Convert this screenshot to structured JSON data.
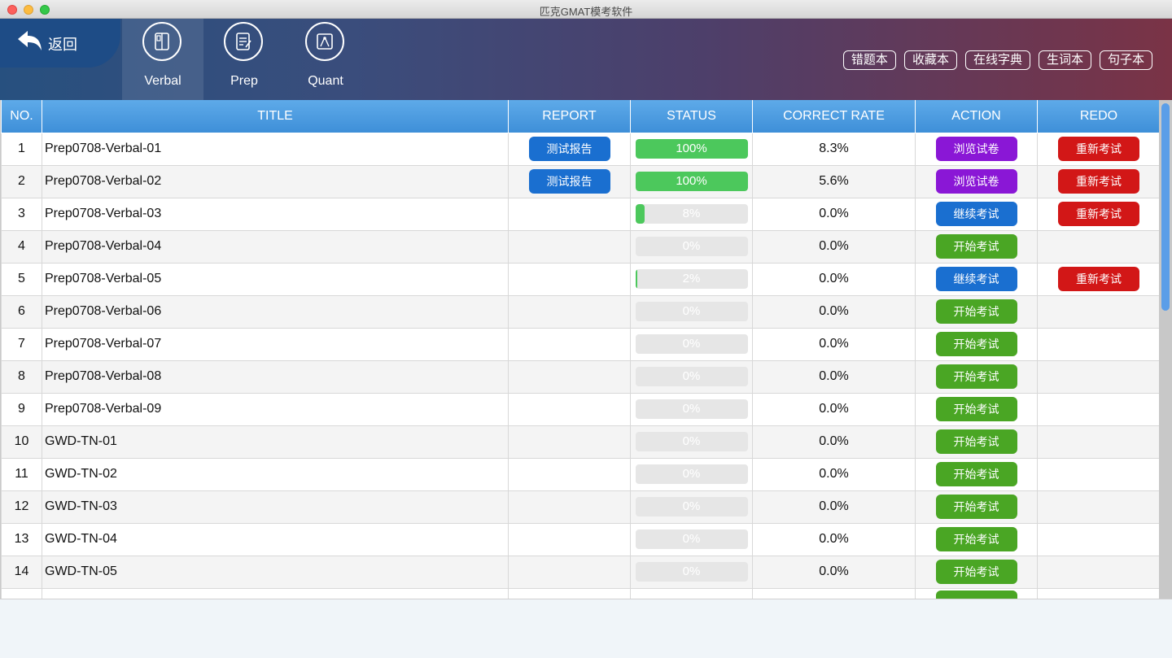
{
  "window": {
    "title": "匹克GMAT模考软件"
  },
  "header": {
    "back_label": "返回",
    "tabs": [
      {
        "label": "Verbal",
        "icon": "book-icon",
        "active": true
      },
      {
        "label": "Prep",
        "icon": "notes-icon",
        "active": false
      },
      {
        "label": "Quant",
        "icon": "compass-icon",
        "active": false
      }
    ],
    "tools": [
      "错题本",
      "收藏本",
      "在线字典",
      "生词本",
      "句子本"
    ]
  },
  "colors": {
    "progress": "#4cc85c",
    "report": "#1a6fd0",
    "browse": "#8a17d6",
    "continue": "#1a6fd0",
    "start": "#4aa624",
    "redo": "#d21717"
  },
  "table": {
    "columns": [
      "NO.",
      "TITLE",
      "REPORT",
      "STATUS",
      "CORRECT RATE",
      "ACTION",
      "REDO"
    ],
    "rows": [
      {
        "no": "1",
        "title": "Prep0708-Verbal-01",
        "report": "测试报告",
        "progress": 100,
        "status": "100%",
        "rate": "8.3%",
        "action": "浏览试卷",
        "action_style": "purple",
        "redo": "重新考试"
      },
      {
        "no": "2",
        "title": "Prep0708-Verbal-02",
        "report": "测试报告",
        "progress": 100,
        "status": "100%",
        "rate": "5.6%",
        "action": "浏览试卷",
        "action_style": "purple",
        "redo": "重新考试"
      },
      {
        "no": "3",
        "title": "Prep0708-Verbal-03",
        "report": "",
        "progress": 8,
        "status": "8%",
        "rate": "0.0%",
        "action": "继续考试",
        "action_style": "blue",
        "redo": "重新考试"
      },
      {
        "no": "4",
        "title": "Prep0708-Verbal-04",
        "report": "",
        "progress": 0,
        "status": "0%",
        "rate": "0.0%",
        "action": "开始考试",
        "action_style": "green",
        "redo": ""
      },
      {
        "no": "5",
        "title": "Prep0708-Verbal-05",
        "report": "",
        "progress": 2,
        "status": "2%",
        "rate": "0.0%",
        "action": "继续考试",
        "action_style": "blue",
        "redo": "重新考试"
      },
      {
        "no": "6",
        "title": "Prep0708-Verbal-06",
        "report": "",
        "progress": 0,
        "status": "0%",
        "rate": "0.0%",
        "action": "开始考试",
        "action_style": "green",
        "redo": ""
      },
      {
        "no": "7",
        "title": "Prep0708-Verbal-07",
        "report": "",
        "progress": 0,
        "status": "0%",
        "rate": "0.0%",
        "action": "开始考试",
        "action_style": "green",
        "redo": ""
      },
      {
        "no": "8",
        "title": "Prep0708-Verbal-08",
        "report": "",
        "progress": 0,
        "status": "0%",
        "rate": "0.0%",
        "action": "开始考试",
        "action_style": "green",
        "redo": ""
      },
      {
        "no": "9",
        "title": "Prep0708-Verbal-09",
        "report": "",
        "progress": 0,
        "status": "0%",
        "rate": "0.0%",
        "action": "开始考试",
        "action_style": "green",
        "redo": ""
      },
      {
        "no": "10",
        "title": "GWD-TN-01",
        "report": "",
        "progress": 0,
        "status": "0%",
        "rate": "0.0%",
        "action": "开始考试",
        "action_style": "green",
        "redo": ""
      },
      {
        "no": "11",
        "title": "GWD-TN-02",
        "report": "",
        "progress": 0,
        "status": "0%",
        "rate": "0.0%",
        "action": "开始考试",
        "action_style": "green",
        "redo": ""
      },
      {
        "no": "12",
        "title": "GWD-TN-03",
        "report": "",
        "progress": 0,
        "status": "0%",
        "rate": "0.0%",
        "action": "开始考试",
        "action_style": "green",
        "redo": ""
      },
      {
        "no": "13",
        "title": "GWD-TN-04",
        "report": "",
        "progress": 0,
        "status": "0%",
        "rate": "0.0%",
        "action": "开始考试",
        "action_style": "green",
        "redo": ""
      },
      {
        "no": "14",
        "title": "GWD-TN-05",
        "report": "",
        "progress": 0,
        "status": "0%",
        "rate": "0.0%",
        "action": "开始考试",
        "action_style": "green",
        "redo": ""
      },
      {
        "no": "",
        "title": "",
        "report": "",
        "progress": 0,
        "status": "",
        "rate": "",
        "action": "",
        "action_style": "green",
        "redo": ""
      }
    ]
  }
}
